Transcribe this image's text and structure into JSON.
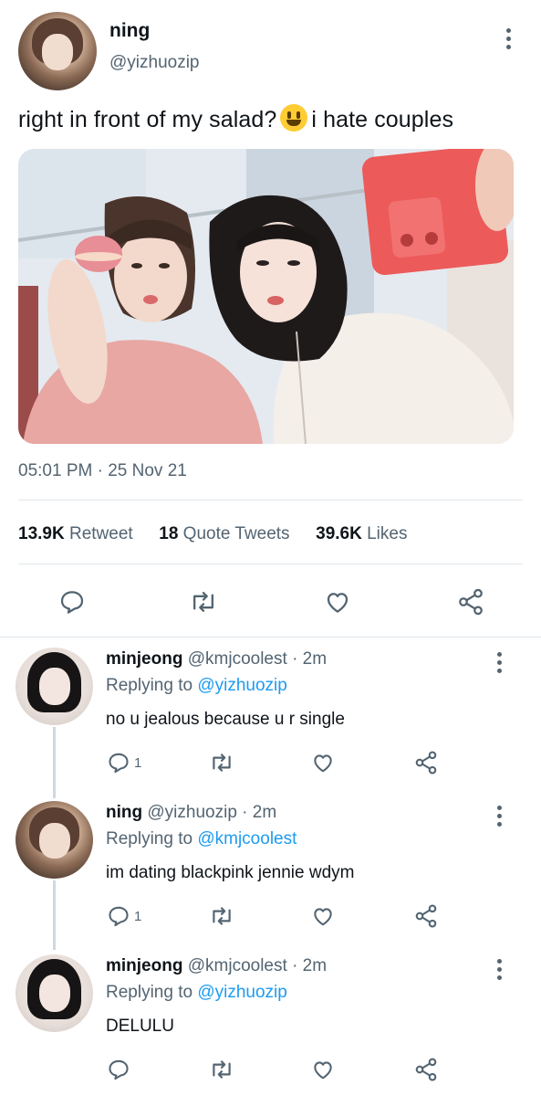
{
  "main_tweet": {
    "display_name": "ning",
    "handle": "@yizhuozip",
    "text_before_emoji": "right in front of my salad?",
    "emoji": "grinning-face-emoji",
    "text_after_emoji": "i hate couples",
    "timestamp": "05:01 PM · 25 Nov 21",
    "stats": {
      "retweets_count": "13.9K",
      "retweets_label": "Retweet",
      "quotes_count": "18",
      "quotes_label": "Quote Tweets",
      "likes_count": "39.6K",
      "likes_label": "Likes"
    }
  },
  "replies": [
    {
      "display_name": "minjeong",
      "handle": "@kmjcoolest",
      "time": "· 2m",
      "replying_prefix": "Replying to",
      "replying_to": "@yizhuozip",
      "text": "no u jealous because u r single",
      "reply_count": "1"
    },
    {
      "display_name": "ning",
      "handle": "@yizhuozip",
      "time": "· 2m",
      "replying_prefix": "Replying to",
      "replying_to": "@kmjcoolest",
      "text": "im dating blackpink jennie wdym",
      "reply_count": "1"
    },
    {
      "display_name": "minjeong",
      "handle": "@kmjcoolest",
      "time": "· 2m",
      "replying_prefix": "Replying to",
      "replying_to": "@yizhuozip",
      "text": "DELULU",
      "reply_count": ""
    }
  ],
  "icons": [
    "reply-icon",
    "retweet-icon",
    "like-icon",
    "share-icon",
    "more-options-icon"
  ],
  "colors": {
    "text": "#0f1419",
    "secondary": "#536471",
    "link": "#1d9bf0",
    "divider": "#e1e6ea",
    "thread_line": "#cfd9de"
  }
}
